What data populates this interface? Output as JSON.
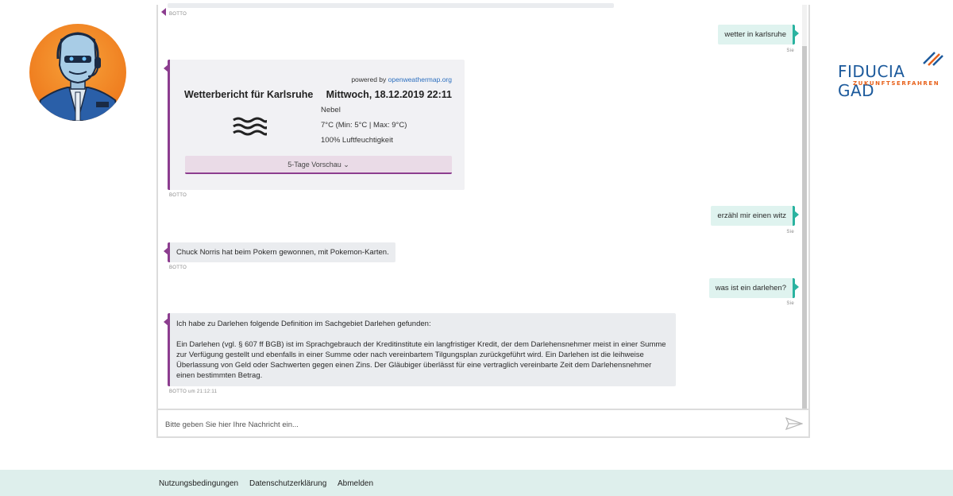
{
  "chat": {
    "messages": [
      {
        "meta": "BOTTO"
      },
      {
        "text": "wetter in karlsruhe",
        "meta": "Sie"
      },
      {
        "meta": "BOTTO"
      },
      {
        "text": "erzähl mir einen witz",
        "meta": "Sie"
      },
      {
        "text": "Chuck Norris hat beim Pokern gewonnen, mit Pokemon-Karten.",
        "meta": "BOTTO"
      },
      {
        "text": "was ist ein darlehen?",
        "meta": "Sie"
      },
      {
        "intro": "Ich habe zu Darlehen folgende Definition im Sachgebiet Darlehen gefunden:",
        "text": "Ein Darlehen (vgl. § 607 ff BGB) ist im Sprachgebrauch der Kreditinstitute ein langfristiger Kredit, der dem Darlehensnehmer meist in einer Summe zur Verfügung gestellt und ebenfalls in einer Summe oder nach vereinbartem Tilgungsplan zurückgeführt wird. Ein Darlehen ist die leihweise Überlassung von Geld oder Sachwerten gegen einen Zins. Der Gläubiger überlässt für eine vertraglich vereinbarte Zeit dem Darlehensnehmer einen bestimmten Betrag.",
        "meta": "BOTTO um 21:12:11"
      }
    ]
  },
  "weather": {
    "powered_prefix": "powered by",
    "powered_link": "openweathermap.org",
    "title": "Wetterbericht für Karlsruhe",
    "date": "Mittwoch, 18.12.2019 22:11",
    "condition": "Nebel",
    "temperature": "7°C (Min: 5°C | Max: 9°C)",
    "humidity": "100% Luftfeuchtigkeit",
    "forecast_label": "5-Tage Vorschau",
    "icon": "fog-icon"
  },
  "input": {
    "placeholder": "Bitte geben Sie hier Ihre Nachricht ein..."
  },
  "logo": {
    "name": "FIDUCIA GAD",
    "tagline": "ZUKUNFTSERFAHREN"
  },
  "footer": {
    "links": [
      "Nutzungsbedingungen",
      "Datenschutzerklärung",
      "Abmelden"
    ]
  },
  "colors": {
    "bot_accent": "#8c3d8f",
    "user_accent": "#2ab3a0",
    "footer_bg": "#deefec",
    "brand_blue": "#1c5a9c",
    "brand_orange": "#e8611a"
  }
}
